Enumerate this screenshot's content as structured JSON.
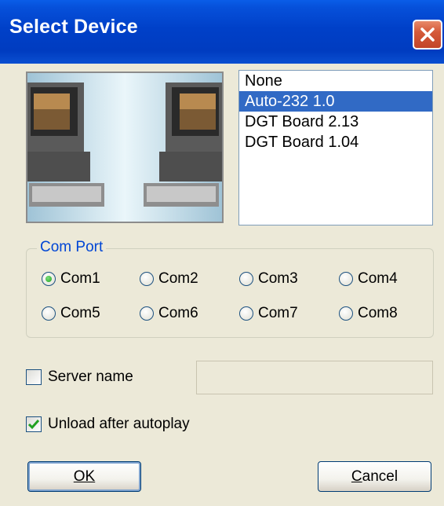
{
  "window": {
    "title": "Select Device"
  },
  "devices": {
    "items": [
      "None",
      "Auto-232 1.0",
      "DGT Board 2.13",
      "DGT Board 1.04"
    ],
    "selected_index": 1
  },
  "com_port": {
    "label": "Com Port",
    "options": [
      "Com1",
      "Com2",
      "Com3",
      "Com4",
      "Com5",
      "Com6",
      "Com7",
      "Com8"
    ],
    "selected": "Com1"
  },
  "server": {
    "label": "Server name",
    "checked": false,
    "value": ""
  },
  "unload": {
    "label": "Unload after autoplay",
    "checked": true
  },
  "buttons": {
    "ok": "OK",
    "cancel": "Cancel"
  },
  "colors": {
    "titlebar": "#0040C8",
    "selection": "#316AC5",
    "group_label": "#0046D5",
    "dialog_bg": "#ECE9D8"
  }
}
